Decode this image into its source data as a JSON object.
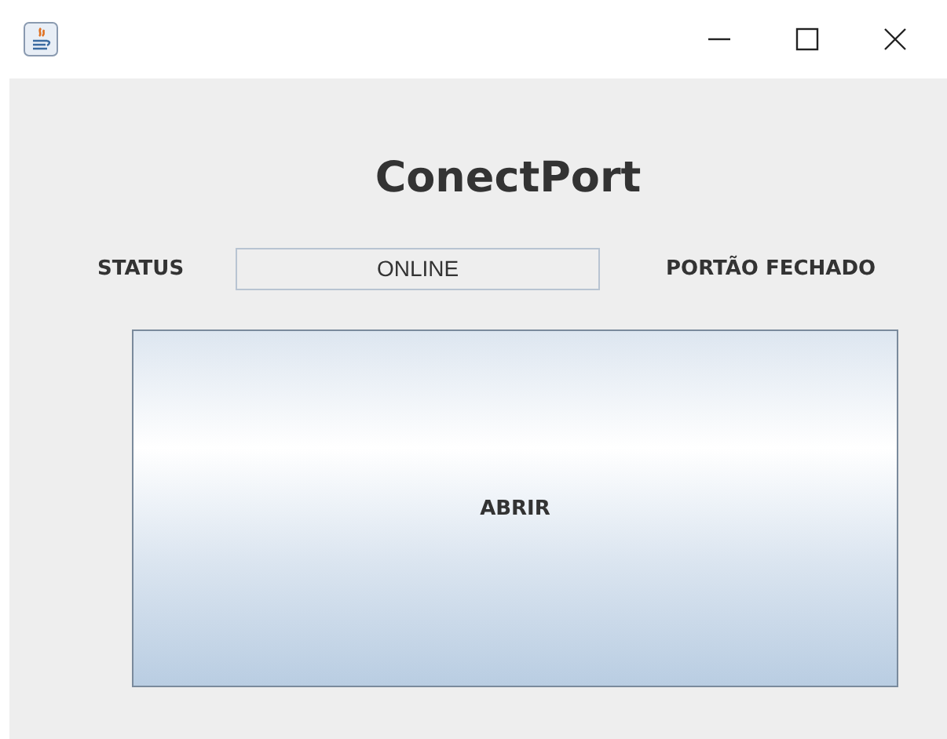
{
  "window": {
    "title_bar_buttons": [
      {
        "kind": "minimize"
      },
      {
        "kind": "maximize"
      },
      {
        "kind": "close"
      }
    ]
  },
  "title": "ConectPort",
  "status": {
    "label": "STATUS",
    "value": "ONLINE",
    "gate": "PORTÃO FECHADO"
  },
  "button": {
    "label": "ABRIR"
  }
}
